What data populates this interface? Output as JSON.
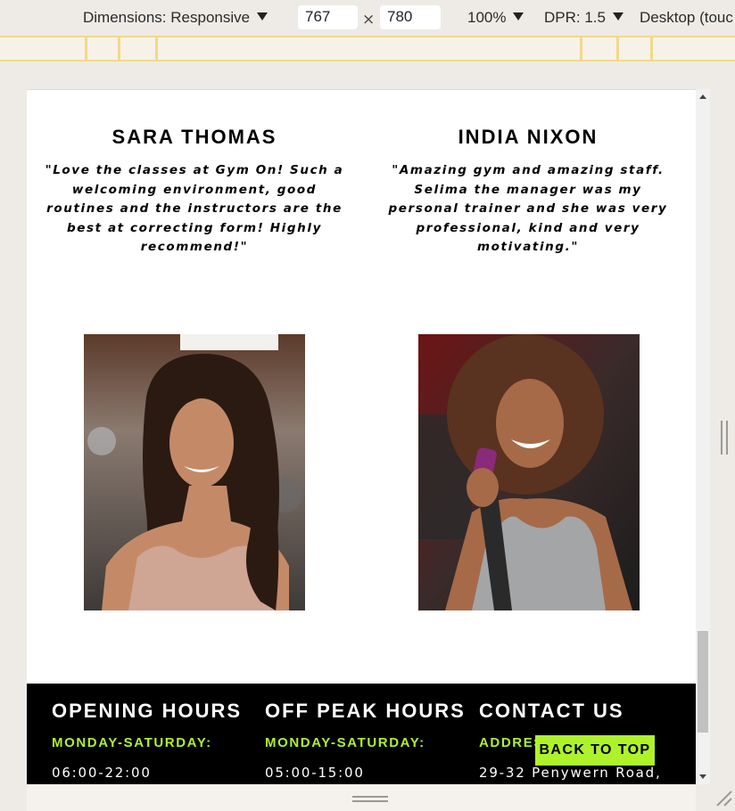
{
  "devtools": {
    "dimensions_label": "Dimensions: Responsive",
    "width_value": "767",
    "times": "×",
    "height_value": "780",
    "zoom_label": "100%",
    "dpr_label": "DPR: 1.5",
    "device_label": "Desktop (touc"
  },
  "reviews": [
    {
      "name": "SARA THOMAS",
      "quote": "\"Love the classes at Gym On! Such a welcoming environment, good routines and the instructors are the best at correcting form! Highly recommend!\""
    },
    {
      "name": "INDIA NIXON",
      "quote": "\"Amazing gym and amazing staff. Selima the manager was my personal trainer and she was very professional, kind and very motivating.\""
    }
  ],
  "footer": {
    "opening_title": "OPENING HOURS",
    "opening_sub": "MONDAY-SATURDAY:",
    "opening_hours": "06:00-22:00",
    "offpeak_title": "OFF PEAK HOURS",
    "offpeak_sub": "MONDAY-SATURDAY:",
    "offpeak_hours": "05:00-15:00",
    "contact_title": "CONTACT US",
    "contact_sub": "ADDRESS",
    "contact_address": "29-32 Penywern Road,"
  },
  "back_to_top_label": "BACK TO TOP",
  "colors": {
    "accent": "#aef22c",
    "footer_bg": "#000000"
  }
}
